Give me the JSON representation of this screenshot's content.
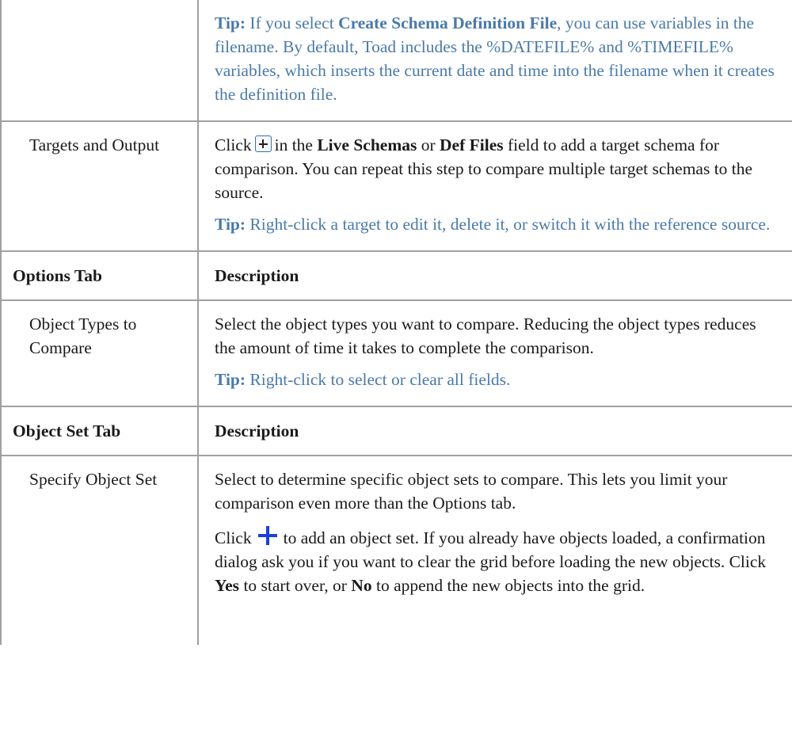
{
  "rows": [
    {
      "type": "content",
      "label": "",
      "p1_tip_label": "Tip:",
      "p1_a": "If you select",
      "p1_bold": "Create Schema Definition File",
      "p1_b": ", you can use variables in the filename. By default, Toad includes the %DATEFILE% and %TIMEFILE% variables, which inserts the current date and time into the filename when it creates the definition file."
    },
    {
      "type": "content",
      "label": "Targets and Output",
      "p1_a": "Click",
      "p1_b": "in the",
      "p1_bold1": "Live Schemas",
      "p1_c": "or",
      "p1_bold2": "Def Files",
      "p1_d": "field to add a target schema for comparison. You can repeat this step to compare multiple target schemas to the source.",
      "p2_tip_label": "Tip:",
      "p2_text": "Right-click a target to edit it, delete it, or switch it with the reference source."
    },
    {
      "type": "header",
      "left": "Options Tab",
      "right": "Description"
    },
    {
      "type": "content",
      "label": "Object Types to Compare",
      "p1": "Select the object types you want to compare. Reducing the object types reduces the amount of time it takes to complete the comparison.",
      "p2_tip_label": "Tip:",
      "p2_text": "Right-click to select or clear all fields."
    },
    {
      "type": "header",
      "left": "Object Set Tab",
      "right": "Description"
    },
    {
      "type": "content",
      "label": "Specify Object Set",
      "p1": "Select to determine specific object sets to compare. This lets you limit your comparison even more than the Options tab.",
      "p2_a": "Click",
      "p2_b": "to add an object set. If you already have objects loaded, a confirmation dialog ask you if you want to clear the grid before loading the new objects. Click",
      "p2_bold1": "Yes",
      "p2_c": "to start over, or",
      "p2_bold2": "No",
      "p2_d": "to append the new objects into the grid."
    }
  ],
  "icons": {
    "add_target": "add-box-icon",
    "add_object_set": "plus-icon"
  },
  "colors": {
    "tip_text": "#4a7aa8",
    "border": "#a0a0a0",
    "plus_blue": "#1a3fe0"
  }
}
